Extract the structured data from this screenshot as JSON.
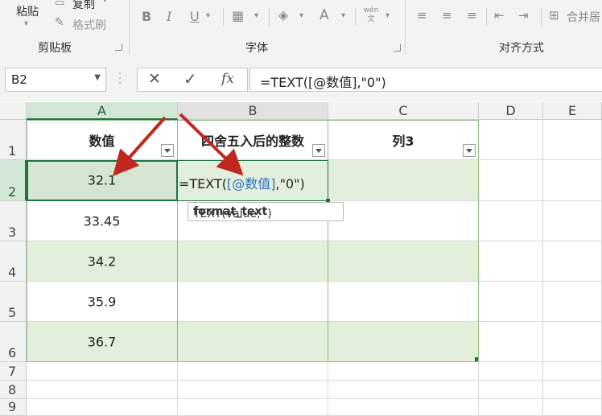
{
  "ribbon": {
    "clipboard": {
      "paste_label": "粘贴",
      "copy_label": "复制",
      "format_painter_label": "格式刷",
      "group_label": "剪贴板"
    },
    "font": {
      "bold": "B",
      "italic": "I",
      "underline": "U",
      "font_color": "A",
      "phonetic": "wén 文",
      "group_label": "字体"
    },
    "alignment": {
      "merge_label": "合并居",
      "group_label": "对齐方式"
    }
  },
  "formula_bar": {
    "name_box": "B2",
    "cancel_icon": "✕",
    "enter_icon": "✓",
    "fx_label": "fx",
    "formula": "=TEXT([@数值],\"0\")"
  },
  "grid": {
    "columns": [
      "A",
      "B",
      "C",
      "D",
      "E"
    ],
    "rows": [
      "1",
      "2",
      "3",
      "4",
      "5",
      "6",
      "7",
      "8",
      "9"
    ],
    "table_headers": [
      "数值",
      "四舍五入后的整数",
      "列3"
    ],
    "values": [
      "32.1",
      "33.45",
      "34.2",
      "35.9",
      "36.7"
    ],
    "edit": {
      "prefix": "=TEXT(",
      "ref": "[@数值]",
      "suffix": ",\"0\")"
    },
    "tooltip": {
      "func": "TEXT(value, ",
      "arg": "format_text",
      "close": ")"
    }
  },
  "colors": {
    "accent": "#217346",
    "band": "#e2efda",
    "arrow": "#c0281f",
    "ref_blue": "#2f6fbf"
  }
}
